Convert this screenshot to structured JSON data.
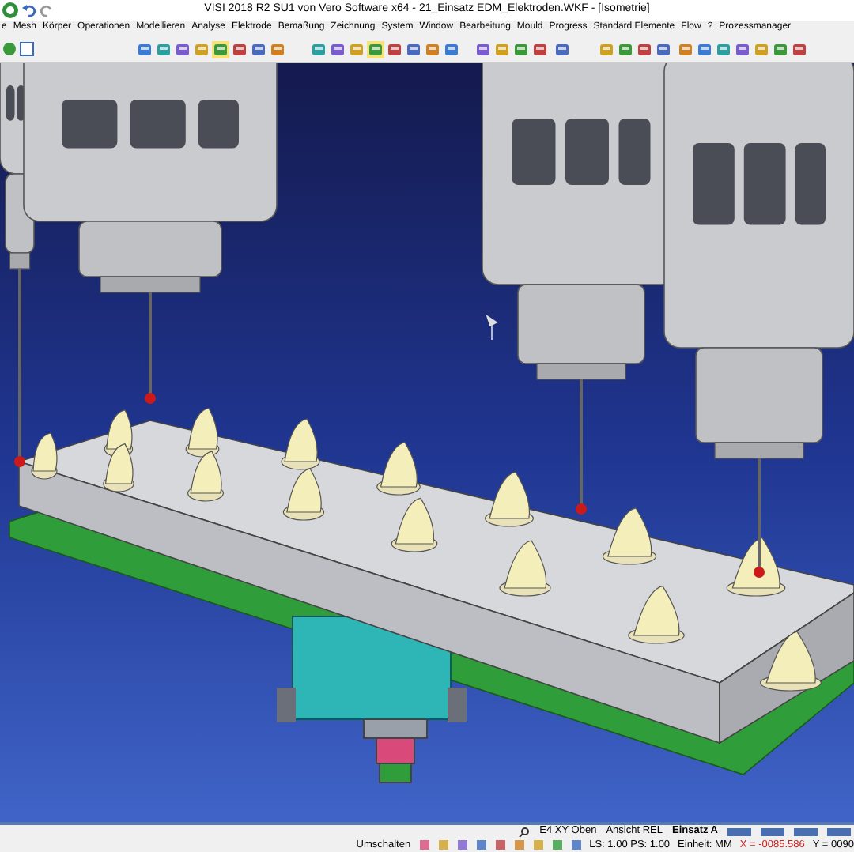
{
  "window": {
    "title": "VISI 2018 R2 SU1 von Vero Software x64 - 21_Einsatz EDM_Elektroden.WKF - [Isometrie]"
  },
  "menu": [
    "e",
    "Mesh",
    "Körper",
    "Operationen",
    "Modellieren",
    "Analyse",
    "Elektrode",
    "Bemaßung",
    "Zeichnung",
    "System",
    "Window",
    "Bearbeitung",
    "Mould",
    "Progress",
    "Standard Elemente",
    "Flow",
    "?",
    "Prozessmanager"
  ],
  "status_bar": {
    "view_plane": "E4 XY Oben",
    "view_mode": "Ansicht REL",
    "insert": "Einsatz A",
    "toggle_button": "Umschalten",
    "scale": "LS: 1.00 PS: 1.00",
    "unit": "Einheit: MM",
    "x_coordinate": "X = -0085.586",
    "y_coordinate": "Y = 0090"
  }
}
